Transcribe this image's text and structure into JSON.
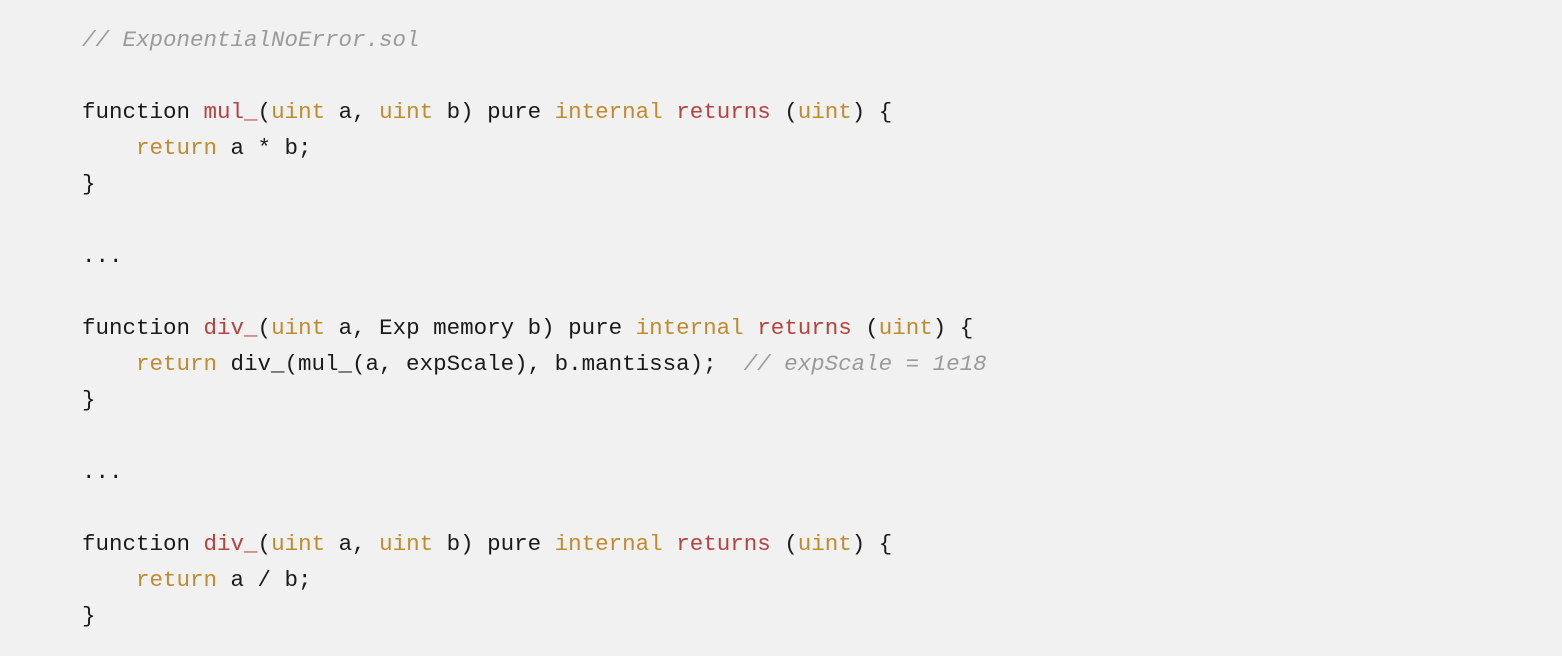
{
  "code": {
    "lines": [
      [
        {
          "cls": "c-comment",
          "text": "// ExponentialNoError.sol"
        }
      ],
      [
        {
          "cls": "c-plain",
          "text": ""
        }
      ],
      [
        {
          "cls": "c-plain",
          "text": "function "
        },
        {
          "cls": "c-fnname",
          "text": "mul_"
        },
        {
          "cls": "c-plain",
          "text": "("
        },
        {
          "cls": "c-type",
          "text": "uint"
        },
        {
          "cls": "c-plain",
          "text": " a, "
        },
        {
          "cls": "c-type",
          "text": "uint"
        },
        {
          "cls": "c-plain",
          "text": " b) pure "
        },
        {
          "cls": "c-keyword-vis",
          "text": "internal"
        },
        {
          "cls": "c-plain",
          "text": " "
        },
        {
          "cls": "c-keyword-ret",
          "text": "returns"
        },
        {
          "cls": "c-plain",
          "text": " ("
        },
        {
          "cls": "c-type",
          "text": "uint"
        },
        {
          "cls": "c-plain",
          "text": ") {"
        }
      ],
      [
        {
          "cls": "c-plain",
          "text": "    "
        },
        {
          "cls": "c-keyword-return",
          "text": "return"
        },
        {
          "cls": "c-plain",
          "text": " a * b;"
        }
      ],
      [
        {
          "cls": "c-plain",
          "text": "}"
        }
      ],
      [
        {
          "cls": "c-plain",
          "text": ""
        }
      ],
      [
        {
          "cls": "c-plain",
          "text": "..."
        }
      ],
      [
        {
          "cls": "c-plain",
          "text": ""
        }
      ],
      [
        {
          "cls": "c-plain",
          "text": "function "
        },
        {
          "cls": "c-fnname",
          "text": "div_"
        },
        {
          "cls": "c-plain",
          "text": "("
        },
        {
          "cls": "c-type",
          "text": "uint"
        },
        {
          "cls": "c-plain",
          "text": " a, Exp memory b) pure "
        },
        {
          "cls": "c-keyword-vis",
          "text": "internal"
        },
        {
          "cls": "c-plain",
          "text": " "
        },
        {
          "cls": "c-keyword-ret",
          "text": "returns"
        },
        {
          "cls": "c-plain",
          "text": " ("
        },
        {
          "cls": "c-type",
          "text": "uint"
        },
        {
          "cls": "c-plain",
          "text": ") {"
        }
      ],
      [
        {
          "cls": "c-plain",
          "text": "    "
        },
        {
          "cls": "c-keyword-return",
          "text": "return"
        },
        {
          "cls": "c-plain",
          "text": " div_(mul_(a, expScale), b.mantissa);  "
        },
        {
          "cls": "c-comment",
          "text": "// expScale = 1e18"
        }
      ],
      [
        {
          "cls": "c-plain",
          "text": "}"
        }
      ],
      [
        {
          "cls": "c-plain",
          "text": ""
        }
      ],
      [
        {
          "cls": "c-plain",
          "text": "..."
        }
      ],
      [
        {
          "cls": "c-plain",
          "text": ""
        }
      ],
      [
        {
          "cls": "c-plain",
          "text": "function "
        },
        {
          "cls": "c-fnname",
          "text": "div_"
        },
        {
          "cls": "c-plain",
          "text": "("
        },
        {
          "cls": "c-type",
          "text": "uint"
        },
        {
          "cls": "c-plain",
          "text": " a, "
        },
        {
          "cls": "c-type",
          "text": "uint"
        },
        {
          "cls": "c-plain",
          "text": " b) pure "
        },
        {
          "cls": "c-keyword-vis",
          "text": "internal"
        },
        {
          "cls": "c-plain",
          "text": " "
        },
        {
          "cls": "c-keyword-ret",
          "text": "returns"
        },
        {
          "cls": "c-plain",
          "text": " ("
        },
        {
          "cls": "c-type",
          "text": "uint"
        },
        {
          "cls": "c-plain",
          "text": ") {"
        }
      ],
      [
        {
          "cls": "c-plain",
          "text": "    "
        },
        {
          "cls": "c-keyword-return",
          "text": "return"
        },
        {
          "cls": "c-plain",
          "text": " a / b;"
        }
      ],
      [
        {
          "cls": "c-plain",
          "text": "}"
        }
      ]
    ]
  }
}
